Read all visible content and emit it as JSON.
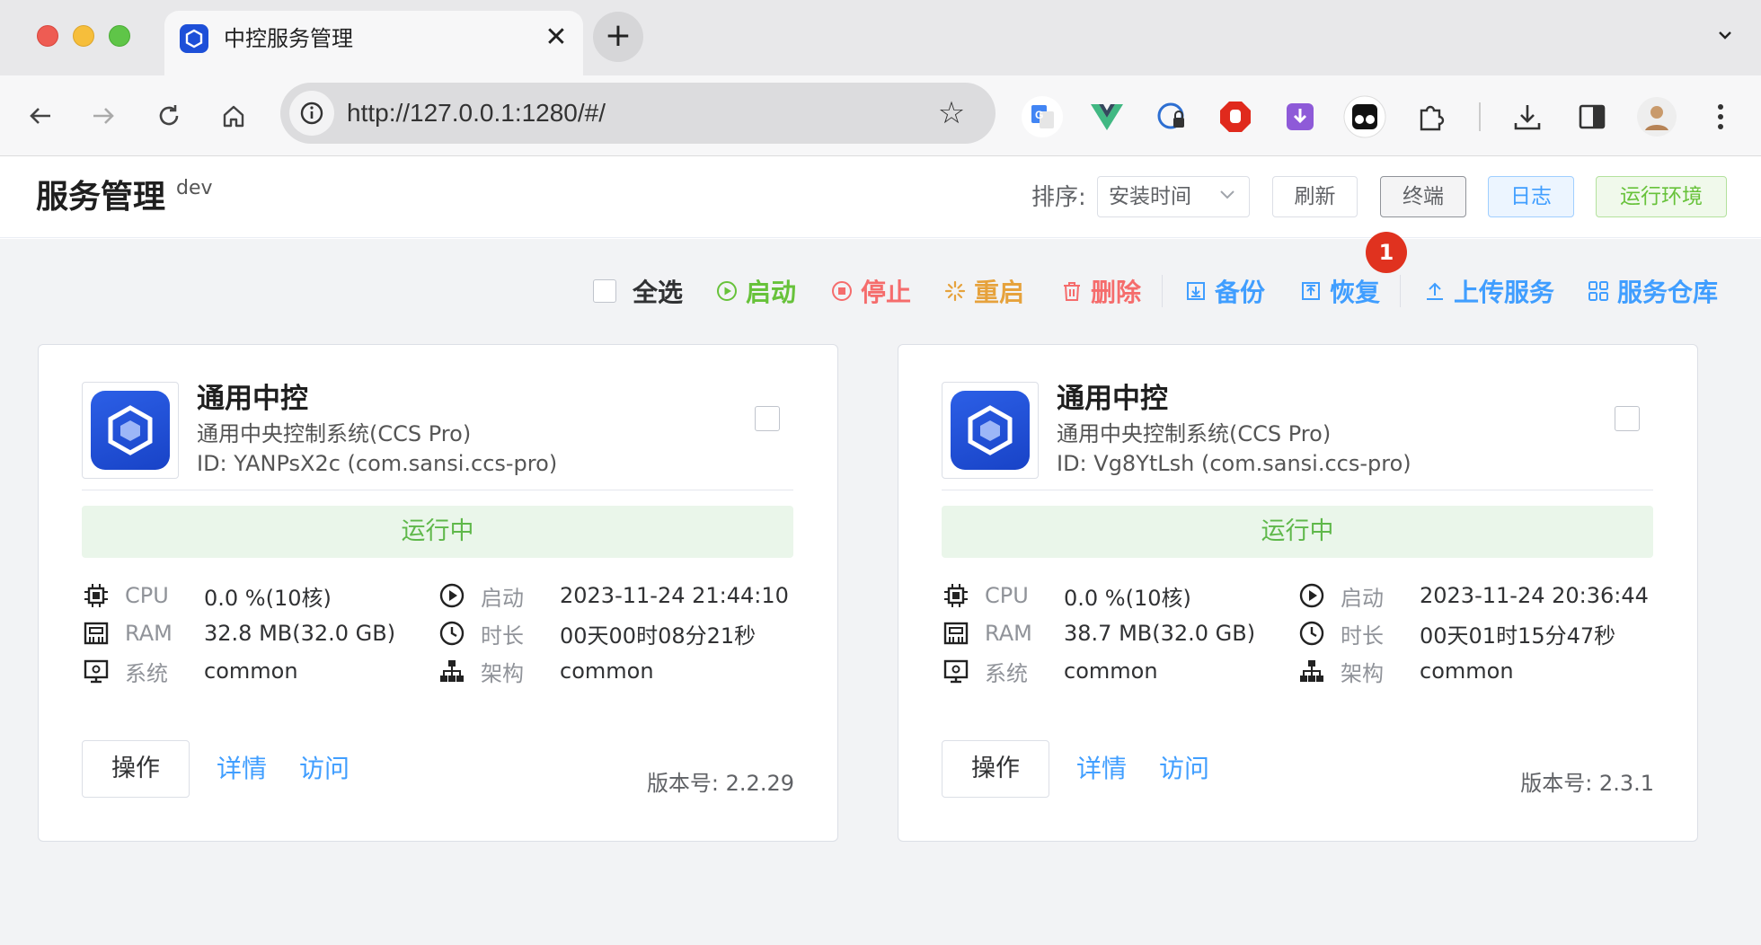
{
  "browser": {
    "tab_title": "中控服务管理",
    "tab_close": "✕",
    "new_tab": "+",
    "url": "http://127.0.0.1:1280/#/",
    "extensions": [
      "google-translate",
      "vue-devtools",
      "privacy",
      "adblock",
      "downloader",
      "tampermonkey",
      "puzzle",
      "download",
      "sidebar",
      "avatar",
      "menu"
    ]
  },
  "app": {
    "title": "服务管理",
    "env": "dev",
    "sort_label": "排序:",
    "sort_value": "安装时间",
    "buttons": {
      "refresh": "刷新",
      "terminal": "终端",
      "log": "日志",
      "runtime": "运行环境"
    }
  },
  "badge": "1",
  "actions": {
    "select_all": "全选",
    "start": "启动",
    "stop": "停止",
    "restart": "重启",
    "delete": "删除",
    "backup": "备份",
    "restore": "恢复",
    "upload": "上传服务",
    "repo": "服务仓库"
  },
  "colors": {
    "start": "#67c23a",
    "stop": "#f56c6c",
    "restart": "#e6a23c",
    "blue": "#409eff"
  },
  "cards": [
    {
      "name": "通用中控",
      "desc": "通用中央控制系统(CCS Pro)",
      "id": "ID: YANPsX2c (com.sansi.ccs-pro)",
      "status": "运行中",
      "cpu_label": "CPU",
      "cpu": "0.0 %(10核)",
      "ram_label": "RAM",
      "ram": "32.8 MB(32.0 GB)",
      "os_label": "系统",
      "os": "common",
      "start_label": "启动",
      "start": "2023-11-24 21:44:10",
      "uptime_label": "时长",
      "uptime": "00天00时08分21秒",
      "arch_label": "架构",
      "arch": "common",
      "op": "操作",
      "detail": "详情",
      "visit": "访问",
      "version": "版本号: 2.2.29"
    },
    {
      "name": "通用中控",
      "desc": "通用中央控制系统(CCS Pro)",
      "id": "ID: Vg8YtLsh (com.sansi.ccs-pro)",
      "status": "运行中",
      "cpu_label": "CPU",
      "cpu": "0.0 %(10核)",
      "ram_label": "RAM",
      "ram": "38.7 MB(32.0 GB)",
      "os_label": "系统",
      "os": "common",
      "start_label": "启动",
      "start": "2023-11-24 20:36:44",
      "uptime_label": "时长",
      "uptime": "00天01时15分47秒",
      "arch_label": "架构",
      "arch": "common",
      "op": "操作",
      "detail": "详情",
      "visit": "访问",
      "version": "版本号: 2.3.1"
    }
  ]
}
